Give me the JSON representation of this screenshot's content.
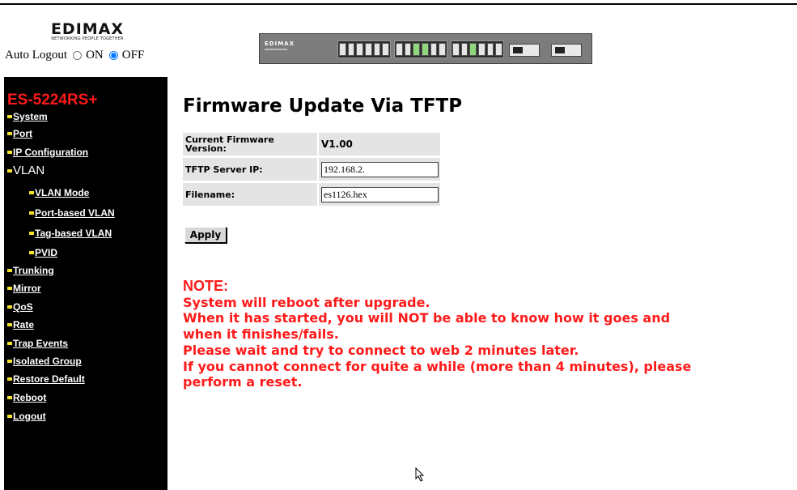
{
  "header": {
    "logo_text": "EDIMAX",
    "logo_tagline": "NETWORKING PEOPLE TOGETHER",
    "auto_logout_label": "Auto Logout",
    "auto_logout_on": "ON",
    "auto_logout_off": "OFF",
    "auto_logout_selected": "OFF",
    "switch_brand": "EDIMAX"
  },
  "sidebar": {
    "model": "ES-5224RS+",
    "items": [
      {
        "label": "System"
      },
      {
        "label": "Port"
      },
      {
        "label": "IP Configuration"
      },
      {
        "label": "VLAN"
      },
      {
        "label": "VLAN Mode"
      },
      {
        "label": "Port-based VLAN"
      },
      {
        "label": "Tag-based VLAN"
      },
      {
        "label": "PVID"
      },
      {
        "label": "Trunking"
      },
      {
        "label": "Mirror"
      },
      {
        "label": "QoS"
      },
      {
        "label": "Rate"
      },
      {
        "label": "Trap Events"
      },
      {
        "label": "Isolated Group"
      },
      {
        "label": "Restore Default"
      },
      {
        "label": "Reboot"
      },
      {
        "label": "Logout"
      }
    ]
  },
  "main": {
    "title": "Firmware Update Via TFTP",
    "fields": {
      "current_firmware_label": "Current Firmware Version:",
      "current_firmware_value": "V1.00",
      "tftp_server_label": "TFTP Server IP:",
      "tftp_server_value": "192.168.2.",
      "filename_label": "Filename:",
      "filename_value": "es1126.hex"
    },
    "apply_label": "Apply",
    "note": {
      "title": "NOTE:",
      "lines": [
        "System will reboot after upgrade.",
        "When it has started, you will NOT be able to know how it goes and",
        "when it finishes/fails.",
        "Please wait and try to connect to web 2 minutes later.",
        "If you cannot connect for quite a while (more than 4 minutes), please",
        "perform a reset."
      ]
    }
  },
  "colors": {
    "sidebar_bg": "#000000",
    "model_text": "#ff1a1a",
    "note_text": "#ff1a1a",
    "nav_bullet": "#f4e22a",
    "field_bg": "#e4e4e4"
  },
  "icons": {
    "nav_bullet": "yellow-bullet-icon",
    "cursor": "mouse-pointer-icon"
  }
}
